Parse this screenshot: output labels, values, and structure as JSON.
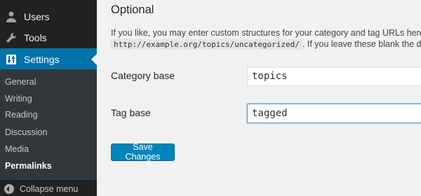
{
  "sidebar": {
    "top_partial_label": "",
    "items": [
      {
        "label": "Users",
        "icon": "users-icon"
      },
      {
        "label": "Tools",
        "icon": "tools-icon"
      },
      {
        "label": "Settings",
        "icon": "settings-icon",
        "active": true
      }
    ],
    "submenu": [
      "General",
      "Writing",
      "Reading",
      "Discussion",
      "Media",
      "Permalinks"
    ],
    "submenu_current": "Permalinks",
    "collapse_label": "Collapse menu"
  },
  "main": {
    "section_title": "Optional",
    "description_line1": "If you like, you may enter custom structures for your category and tag URLs here. Fo",
    "code_example": "http://example.org/topics/uncategorized/",
    "description_line2_tail": ". If you leave these blank the defaul",
    "category_base_label": "Category base",
    "category_base_value": "topics",
    "tag_base_label": "Tag base",
    "tag_base_value": "tagged",
    "save_button_label": "Save Changes"
  },
  "colors": {
    "sidebar_bg": "#222222",
    "submenu_bg": "#32373c",
    "accent": "#0073aa",
    "button": "#0085ba"
  }
}
